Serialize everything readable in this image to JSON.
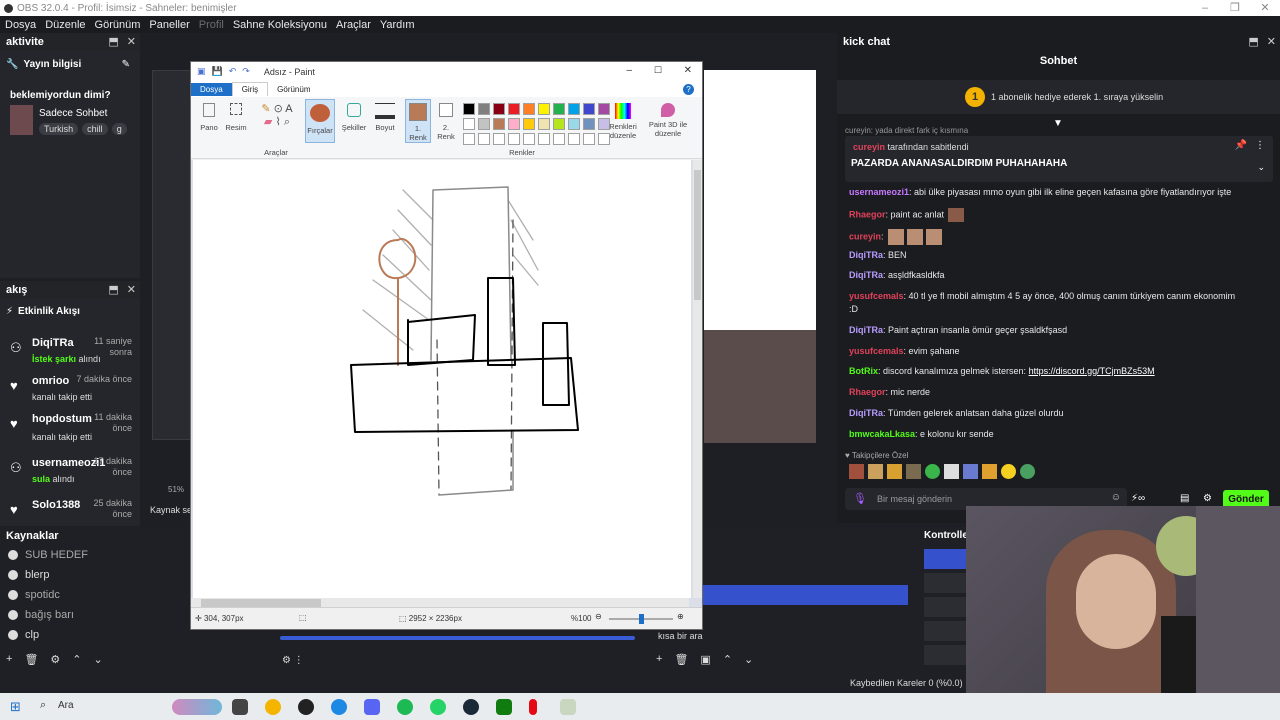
{
  "window": {
    "title": "OBS 32.0.4 - Profil: İsimsiz - Sahneler: benimişler",
    "controls": [
      "–",
      "❐",
      "✕"
    ]
  },
  "menu": [
    "Dosya",
    "Düzenle",
    "Görünüm",
    "Paneller",
    "Profil",
    "Sahne Koleksiyonu",
    "Araçlar",
    "Yardım"
  ],
  "aktivite": {
    "dock_title": "aktivite",
    "section": "Yayın bilgisi",
    "question": "beklemiyordun dimi?",
    "stream_title": "Sadece Sohbet",
    "tags": [
      "Turkish",
      "chill",
      "g"
    ]
  },
  "akis": {
    "dock_title": "akış",
    "section": "Etkinlik Akışı",
    "events": [
      {
        "name": "DiqiTRa",
        "time": "11 saniye sonra",
        "line_green": "İstek şarkı",
        "line_rest": " alındı",
        "icon": "people-icon"
      },
      {
        "name": "omrioo",
        "time": "7 dakika önce",
        "line_green": "",
        "line_rest": "kanalı takip etti",
        "icon": "heart-icon"
      },
      {
        "name": "hopdostum",
        "time": "11 dakika önce",
        "line_green": "",
        "line_rest": "kanalı takip etti",
        "icon": "heart-icon"
      },
      {
        "name": "usernameozi1",
        "time": "17 dakika önce",
        "line_green": "sula",
        "line_rest": " alındı",
        "icon": "people-icon"
      },
      {
        "name": "Solo1388",
        "time": "25 dakika önce",
        "line_green": "",
        "line_rest": "",
        "icon": "heart-icon"
      }
    ]
  },
  "obs": {
    "kaynak_cut": "Kaynak se",
    "sources_title": "Kaynaklar",
    "sources": [
      "SUB HEDEF",
      "blerp",
      "spotidc",
      "bağış barı",
      "clp"
    ],
    "controls_title": "Kontrolle",
    "audio_label": "kısa bir ara",
    "dropped_frames": "Kaybedilen Kareler 0 (%0.0)",
    "zoom_small": "51%"
  },
  "paint": {
    "title": "Adsız - Paint",
    "tabs": [
      "Dosya",
      "Giriş",
      "Görünüm"
    ],
    "groups": {
      "pano": "Pano",
      "resim": "Resim",
      "araclar": "Araçlar",
      "fircalar": "Fırçalar",
      "sekiller": "Şekiller",
      "boyut": "Boyut",
      "renk1": "1. Renk",
      "renk2": "2. Renk",
      "renkler": "Renkler",
      "renkleri_duzenle": "Renkleri düzenle",
      "paint3d": "Paint 3D ile düzenle"
    },
    "palette_top": [
      "#000000",
      "#7f7f7f",
      "#880015",
      "#ed1c24",
      "#ff7f27",
      "#fff200",
      "#22b14c",
      "#00a2e8",
      "#3f48cc",
      "#a349a4"
    ],
    "palette_bottom": [
      "#ffffff",
      "#c3c3c3",
      "#b97a57",
      "#ffaec9",
      "#ffc90e",
      "#efe4b0",
      "#b5e61d",
      "#99d9ea",
      "#7092be",
      "#c8bfe7"
    ],
    "color1": "#b97a57",
    "cursor_pos": "304, 307px",
    "image_size": "2952 × 2236px",
    "zoom": "%100"
  },
  "chat": {
    "dock_title": "kick chat",
    "header": "Sohbet",
    "goal_text": "1 abonelik hediye ederek 1. sıraya yükselin",
    "pinned_by_user": "cureyin",
    "pinned_by_rest": " tarafından sabitlendi",
    "pinned_cut": "cureyin: yada direkt fark iç kısmına",
    "pinned_message": "PAZARDA ANANASALDIRDIM PUHAHAHAHA",
    "messages": [
      {
        "user": "usernameozi1",
        "color": "#c678ff",
        "text": ": abi ülke piyasası mmo oyun gibi ilk eline geçen kafasına göre fiyatlandırıyor işte"
      },
      {
        "user": "Rhaegor",
        "color": "#e0425a",
        "text": ": paint ac anlat"
      },
      {
        "user": "cureyin",
        "color": "#e0425a",
        "text": ":"
      },
      {
        "user": "DiqiTRa",
        "color": "#b89cff",
        "text": ": BEN"
      },
      {
        "user": "DiqiTRa",
        "color": "#b89cff",
        "text": ": asşldfkasldkfa"
      },
      {
        "user": "yusufcemals",
        "color": "#e0425a",
        "text": ": 40 tl ye fl mobil almıştım 4 5 ay önce, 400 olmuş canım türkiyem canım ekonomim"
      },
      {
        "user": "DiqiTRa",
        "color": "#b89cff",
        "text": ": Paint açtıran insanla ömür geçer şsaldkfşasd"
      },
      {
        "user": "yusufcemals",
        "color": "#e0425a",
        "text": ": evim şahane"
      },
      {
        "user": "BotRix",
        "color": "#53fc18",
        "text": ": discord kanalımıza gelmek istersen: "
      },
      {
        "user": "Rhaegor",
        "color": "#e0425a",
        "text": ": mic nerde"
      },
      {
        "user": "DiqiTRa",
        "color": "#b89cff",
        "text": ": Tümden gelerek anlatsan daha güzel olurdu"
      },
      {
        "user": "bmwcakaLkasa",
        "color": "#53fc18",
        "text": ": e kolonu kır sende"
      }
    ],
    "link": "https://discord.gg/TCjmBZs53M",
    "text_tail": ":D",
    "followers_label": "Takipçilere Özel",
    "input_placeholder": "Bir mesaj gönderin",
    "send_button": "Gönder"
  },
  "taskbar": {
    "search": "Ara"
  }
}
